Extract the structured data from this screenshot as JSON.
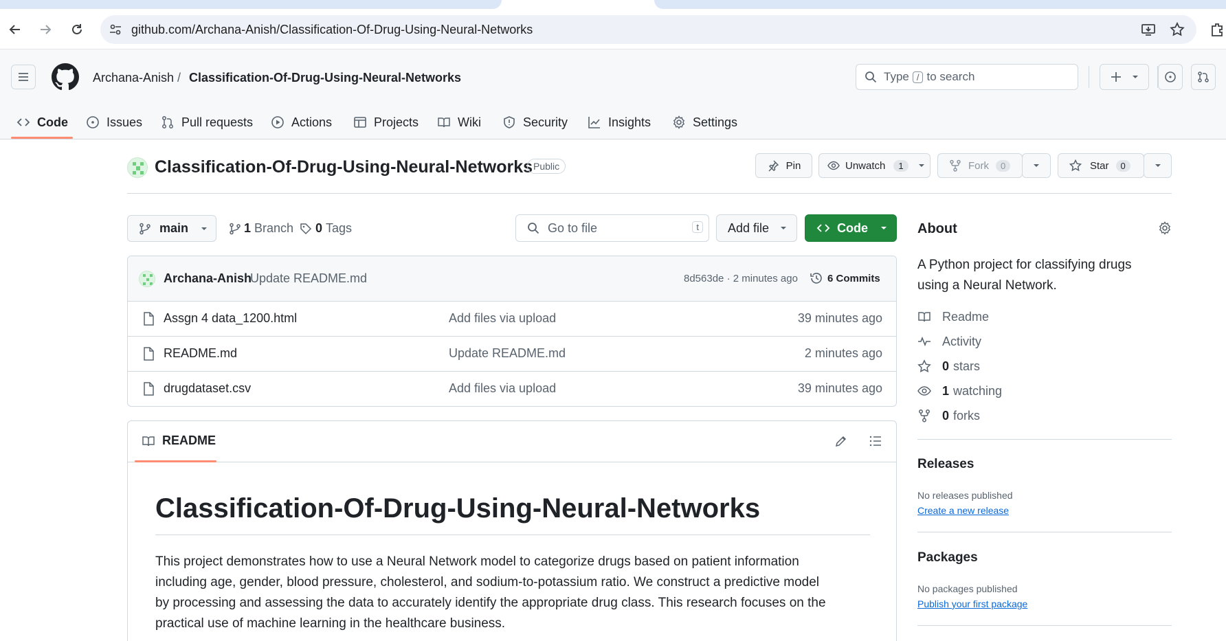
{
  "browser": {
    "url": "github.com/Archana-Anish/Classification-Of-Drug-Using-Neural-Networks"
  },
  "header": {
    "owner": "Archana-Anish",
    "separator": "/",
    "repo": "Classification-Of-Drug-Using-Neural-Networks",
    "search_prefix": "Type",
    "search_key": "/",
    "search_suffix": "to search"
  },
  "tabs": [
    {
      "label": "Code",
      "icon": "code-icon",
      "active": true
    },
    {
      "label": "Issues",
      "icon": "issue-icon"
    },
    {
      "label": "Pull requests",
      "icon": "pull-request-icon"
    },
    {
      "label": "Actions",
      "icon": "play-icon"
    },
    {
      "label": "Projects",
      "icon": "table-icon"
    },
    {
      "label": "Wiki",
      "icon": "book-icon"
    },
    {
      "label": "Security",
      "icon": "shield-icon"
    },
    {
      "label": "Insights",
      "icon": "graph-icon"
    },
    {
      "label": "Settings",
      "icon": "gear-icon"
    }
  ],
  "repo": {
    "title": "Classification-Of-Drug-Using-Neural-Networks",
    "visibility": "Public",
    "pin_label": "Pin",
    "unwatch_label": "Unwatch",
    "unwatch_count": "1",
    "fork_label": "Fork",
    "fork_count": "0",
    "star_label": "Star",
    "star_count": "0"
  },
  "file_nav": {
    "branch": "main",
    "branch_count": "1",
    "branch_label": "Branch",
    "tag_count": "0",
    "tag_label": "Tags",
    "go_to_file": "Go to file",
    "go_to_file_key": "t",
    "add_file": "Add file",
    "code_button": "Code"
  },
  "commit": {
    "author": "Archana-Anish",
    "message": "Update README.md",
    "hash_time": "8d563de · 2 minutes ago",
    "commits_label": "6 Commits"
  },
  "files": [
    {
      "name": "Assgn 4 data_1200.html",
      "message": "Add files via upload",
      "time": "39 minutes ago"
    },
    {
      "name": "README.md",
      "message": "Update README.md",
      "time": "2 minutes ago"
    },
    {
      "name": "drugdataset.csv",
      "message": "Add files via upload",
      "time": "39 minutes ago"
    }
  ],
  "readme": {
    "tab_label": "README",
    "heading": "Classification-Of-Drug-Using-Neural-Networks",
    "para_lines": [
      "This project demonstrates how to use a Neural Network model to categorize drugs based on patient information",
      "including age, gender, blood pressure, cholesterol, and sodium-to-potassium ratio. We construct a predictive model",
      "by processing and assessing the data to accurately identify the appropriate drug class. This research focuses on the",
      "practical use of machine learning in the healthcare business."
    ]
  },
  "about": {
    "title": "About",
    "desc_line1": "A Python project for classifying drugs",
    "desc_line2": "using a Neural Network.",
    "readme": "Readme",
    "activity": "Activity",
    "stars_count": "0",
    "stars_label": "stars",
    "watching_count": "1",
    "watching_label": "watching",
    "forks_count": "0",
    "forks_label": "forks"
  },
  "releases": {
    "title": "Releases",
    "empty": "No releases published",
    "link": "Create a new release"
  },
  "packages": {
    "title": "Packages",
    "empty": "No packages published",
    "link": "Publish your first package"
  },
  "colors": {
    "accent_green": "#1f883d",
    "tab_underline": "#fd8c73",
    "link_blue": "#0969da"
  }
}
